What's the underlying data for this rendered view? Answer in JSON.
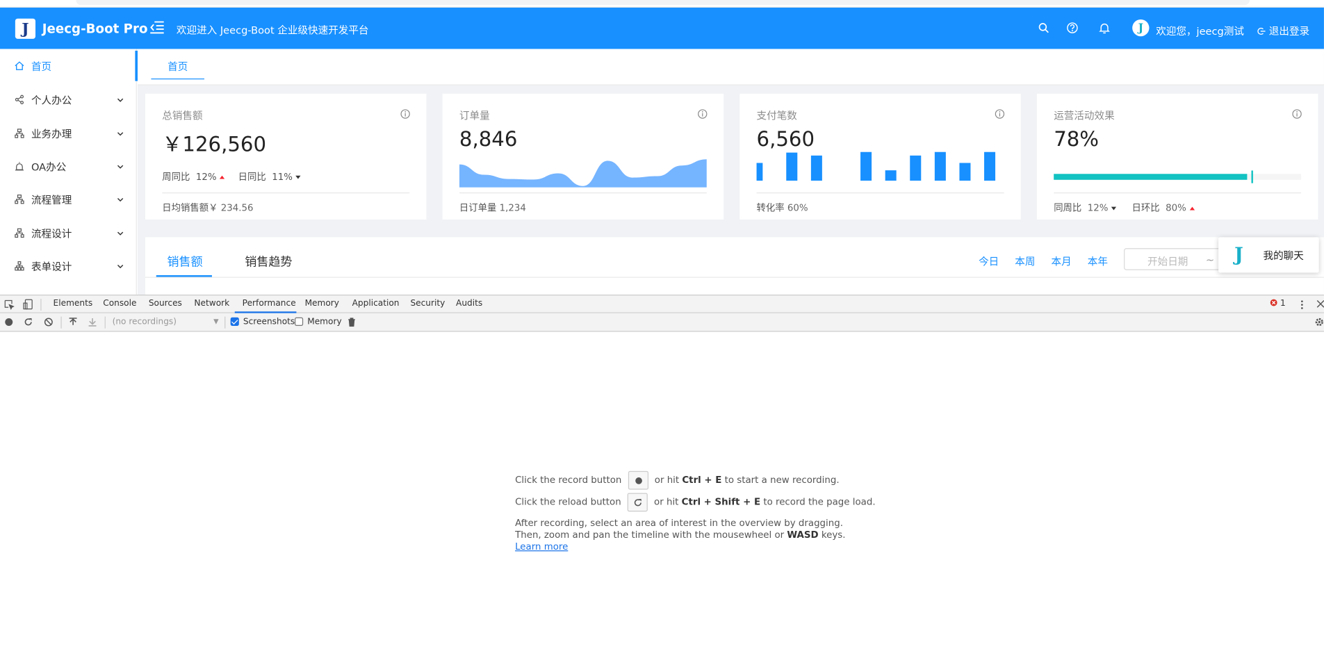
{
  "header": {
    "logo_letter": "J",
    "app_title": "Jeecg-Boot Pro",
    "welcome": "欢迎进入 Jeecg-Boot 企业级快速开发平台",
    "user_greeting": "欢迎您，jeecg测试",
    "logout": "退出登录",
    "brand_color": "#1890ff"
  },
  "sidebar": {
    "items": [
      {
        "label": "首页",
        "icon": "home-icon"
      },
      {
        "label": "个人办公",
        "icon": "share-icon"
      },
      {
        "label": "业务办理",
        "icon": "cluster-icon"
      },
      {
        "label": "OA办公",
        "icon": "alarm-icon"
      },
      {
        "label": "流程管理",
        "icon": "cluster-icon"
      },
      {
        "label": "流程设计",
        "icon": "cluster-icon"
      },
      {
        "label": "表单设计",
        "icon": "apartment-icon"
      }
    ]
  },
  "tabs": {
    "home": "首页"
  },
  "cards": {
    "sales": {
      "title": "总销售额",
      "value": "￥126,560",
      "wow_label": "周同比",
      "wow_value": "12%",
      "dod_label": "日同比",
      "dod_value": "11%",
      "footer_label": "日均销售额￥",
      "footer_value": "234.56"
    },
    "orders": {
      "title": "订单量",
      "value": "8,846",
      "footer_label": "日订单量",
      "footer_value": "1,234",
      "area_series": [
        0.82,
        0.45,
        0.3,
        0.28,
        0.5,
        0.05,
        0.95,
        0.35,
        0.4,
        0.78,
        1.0
      ]
    },
    "payments": {
      "title": "支付笔数",
      "value": "6,560",
      "footer_label": "转化率",
      "footer_value": "60%",
      "bar_values": [
        0.6,
        0.95,
        0.85,
        0,
        0.97,
        0.35,
        0.85,
        0.97,
        0.6,
        0.97
      ]
    },
    "ops": {
      "title": "运营活动效果",
      "value": "78%",
      "progress_percent": 78,
      "target_percent": 80,
      "progress_color": "#13c2c2",
      "yoy_label": "同周比",
      "yoy_value": "12%",
      "dod_label": "日环比",
      "dod_value": "80%"
    }
  },
  "sales_panel": {
    "tab_sales": "销售额",
    "tab_trend": "销售趋势",
    "range_today": "今日",
    "range_week": "本周",
    "range_month": "本月",
    "range_year": "本年",
    "start_date_placeholder": "开始日期",
    "date_separator": "~"
  },
  "chat": {
    "label": "我的聊天"
  },
  "devtools": {
    "tabs": [
      "Elements",
      "Console",
      "Sources",
      "Network",
      "Performance",
      "Memory",
      "Application",
      "Security",
      "Audits"
    ],
    "active_tab": "Performance",
    "error_count": "1",
    "recordings_placeholder": "(no recordings)",
    "screenshots_label": "Screenshots",
    "memory_label": "Memory",
    "screenshots_checked": true,
    "memory_checked": false
  },
  "landing": {
    "line1_pre": "Click the record button",
    "line1_mid": "or hit",
    "line1_key": "Ctrl + E",
    "line1_post": "to start a new recording.",
    "line2_pre": "Click the reload button",
    "line2_mid": "or hit",
    "line2_key": "Ctrl + Shift + E",
    "line2_post": "to record the page load.",
    "line3": "After recording, select an area of interest in the overview by dragging.",
    "line4_pre": "Then, zoom and pan the timeline with the mousewheel or",
    "line4_key": "WASD",
    "line4_post": "keys.",
    "learn_more": "Learn more"
  }
}
